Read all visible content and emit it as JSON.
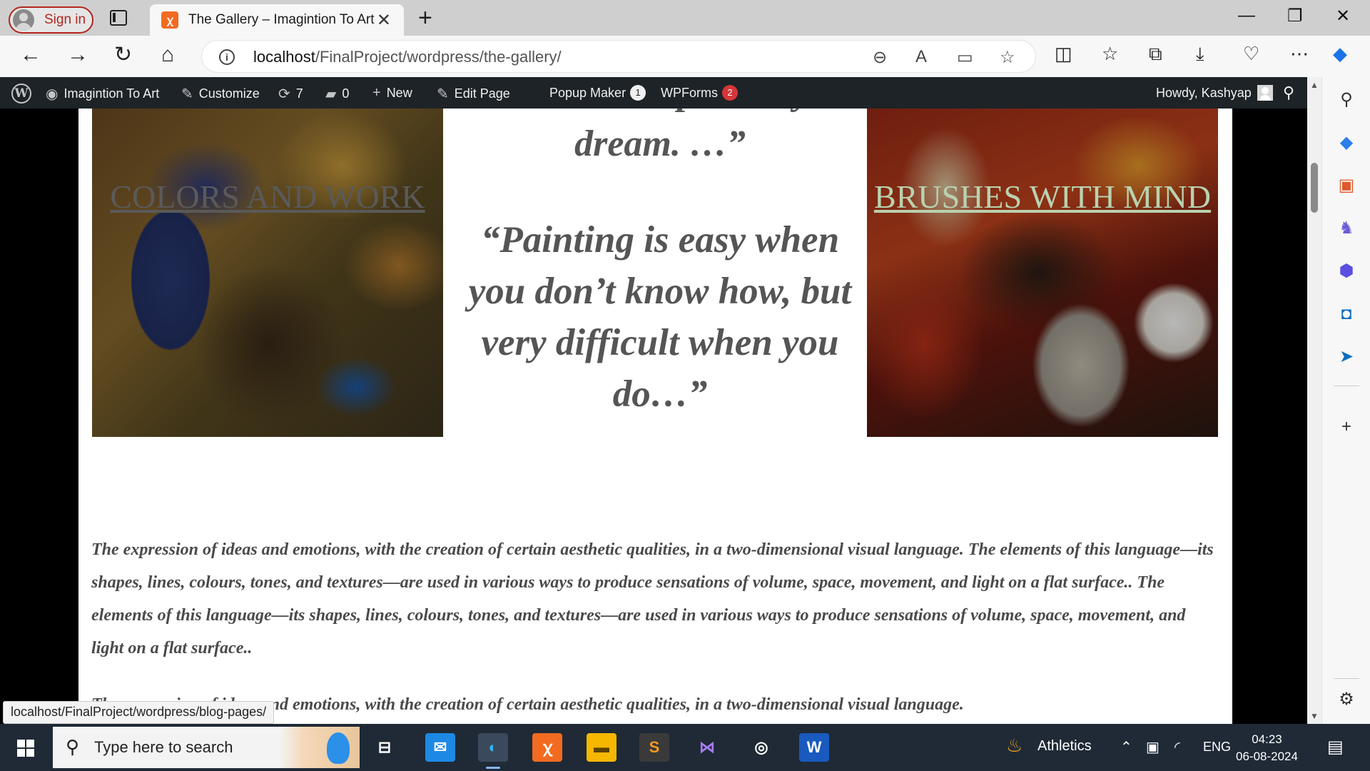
{
  "browser": {
    "signin_label": "Sign in",
    "tab_title": "The Gallery – Imagintion To Art",
    "url_host": "localhost",
    "url_path": "/FinalProject/wordpress/the-gallery/",
    "status_url": "localhost/FinalProject/wordpress/blog-pages/"
  },
  "adminbar": {
    "site_name": "Imagintion To Art",
    "customize": "Customize",
    "updates_count": "7",
    "comments_count": "0",
    "new_label": "New",
    "edit_page": "Edit Page",
    "popup_maker": "Popup Maker",
    "popup_maker_badge": "1",
    "wpforms": "WPForms",
    "wpforms_badge": "2",
    "howdy": "Howdy, Kashyap"
  },
  "gallery": {
    "left_link": "COLORS AND WORK",
    "right_link": "BRUSHES WITH MIND",
    "quote_top_cut": "and then I paint my",
    "quote_top_end": "dream. …”",
    "quote_main": "“Painting is easy when you don’t know how, but very difficult when you do…”"
  },
  "content": {
    "paragraph1": "The expression of ideas and emotions, with the creation of certain aesthetic qualities, in a two-dimensional visual language. The elements of this language—its shapes, lines, colours, tones, and textures—are used in various ways to produce sensations of volume, space, movement, and light on a flat surface.. The elements of this language—its shapes, lines, colours, tones, and textures—are used in various ways to produce sensations of volume, space, movement, and light on a flat surface..",
    "paragraph2": "The expression of ideas and emotions, with the creation of certain aesthetic qualities, in a two-dimensional visual language."
  },
  "taskbar": {
    "search_placeholder": "Type here to search",
    "weather_label": "Athletics",
    "language": "ENG",
    "time": "04:23",
    "date": "06-08-2024"
  },
  "colors": {
    "adminbar_bg": "#1d2327",
    "badge_red": "#d63638",
    "taskbar_bg": "#1f2a36",
    "signin_accent": "#b3261e"
  }
}
